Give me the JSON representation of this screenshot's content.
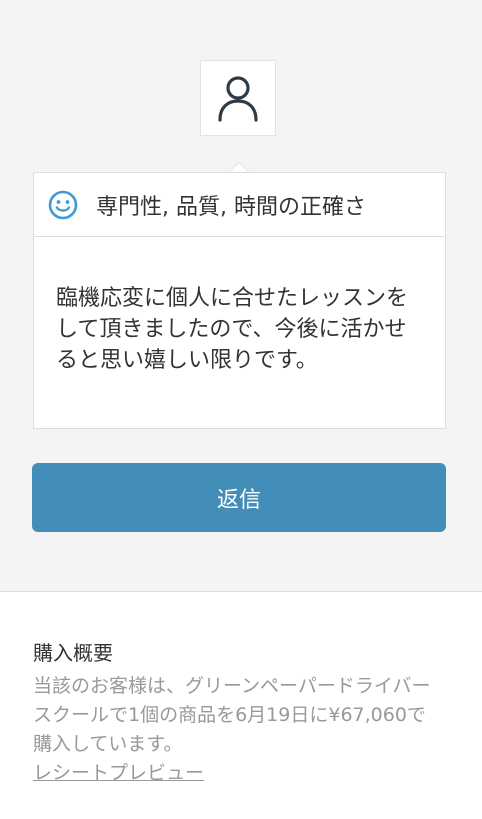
{
  "reviewer": {
    "avatar_icon": "user-icon"
  },
  "review": {
    "rating_icon": "smile-icon",
    "category": "専門性, 品質, 時間の正確さ",
    "comment": "臨機応変に個人に合せたレッスンをして頂きましたので、今後に活かせると思い嬉しい限りです。"
  },
  "actions": {
    "reply_label": "返信"
  },
  "purchase": {
    "title": "購入概要",
    "description": "当該のお客様は、グリーンペーパードライバースクールで1個の商品を6月19日に¥67,060で購入しています。",
    "receipt_link": "レシートプレビュー"
  },
  "colors": {
    "accent": "#438eb9",
    "smile": "#3e9bd6",
    "background": "#f4f4f4"
  }
}
